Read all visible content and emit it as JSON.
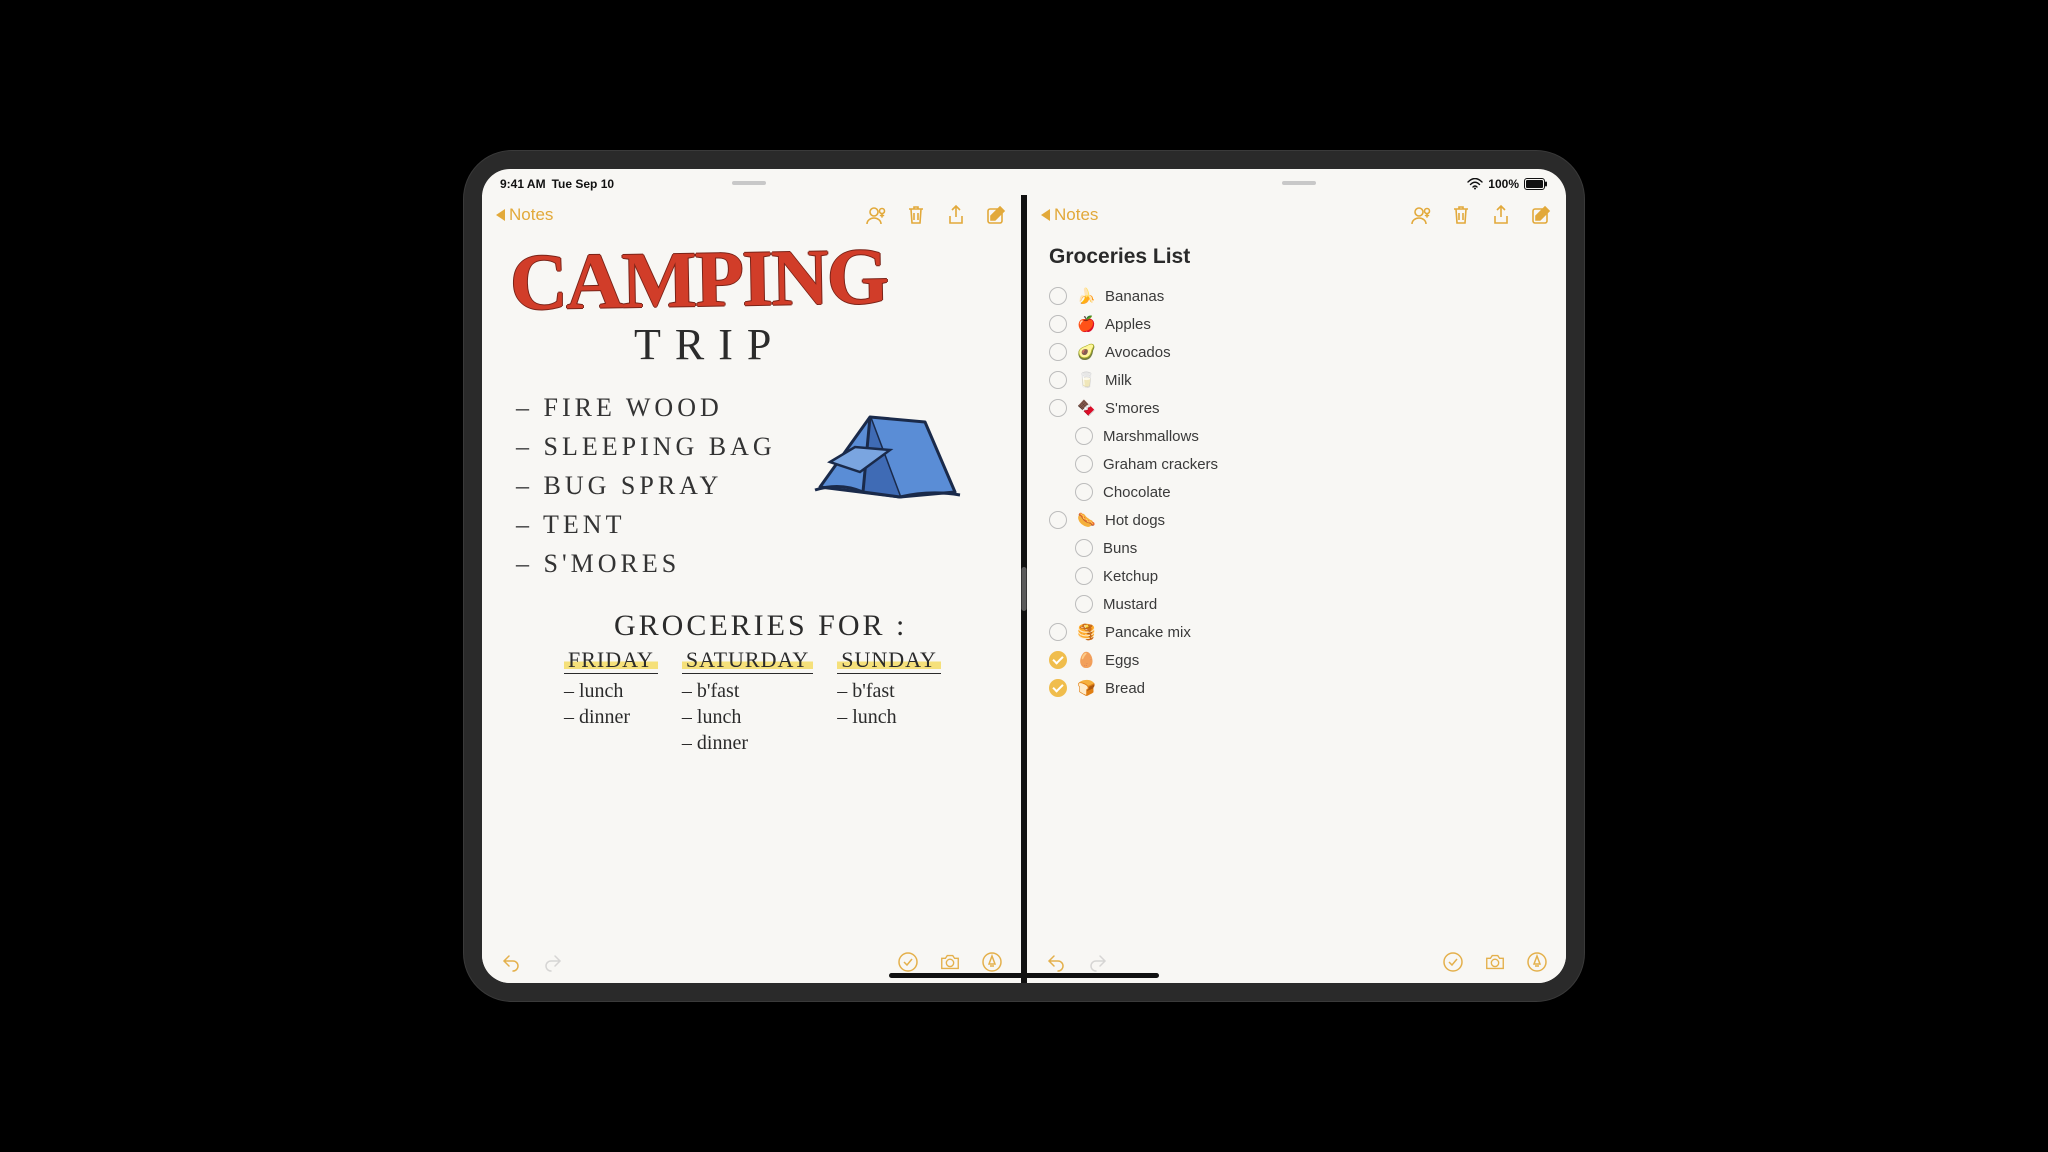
{
  "statusbar": {
    "time": "9:41 AM",
    "date": "Tue Sep 10",
    "battery": "100%"
  },
  "accent": "#e2a93a",
  "left": {
    "back": "Notes",
    "hand_title": "CAMPING",
    "hand_sub": "TRIP",
    "supplies": [
      "FIRE WOOD",
      "SLEEPING BAG",
      "BUG SPRAY",
      "TENT",
      "S'MORES"
    ],
    "groceries_heading": "GROCERIES FOR :",
    "days": [
      {
        "name": "FRIDAY",
        "meals": [
          "lunch",
          "dinner"
        ]
      },
      {
        "name": "SATURDAY",
        "meals": [
          "b'fast",
          "lunch",
          "dinner"
        ]
      },
      {
        "name": "SUNDAY",
        "meals": [
          "b'fast",
          "lunch"
        ]
      }
    ]
  },
  "right": {
    "back": "Notes",
    "title": "Groceries List",
    "items": [
      {
        "emoji": "🍌",
        "label": "Bananas",
        "checked": false,
        "sub": false
      },
      {
        "emoji": "🍎",
        "label": "Apples",
        "checked": false,
        "sub": false
      },
      {
        "emoji": "🥑",
        "label": "Avocados",
        "checked": false,
        "sub": false
      },
      {
        "emoji": "🥛",
        "label": "Milk",
        "checked": false,
        "sub": false
      },
      {
        "emoji": "🍫",
        "label": "S'mores",
        "checked": false,
        "sub": false
      },
      {
        "emoji": "",
        "label": "Marshmallows",
        "checked": false,
        "sub": true
      },
      {
        "emoji": "",
        "label": "Graham crackers",
        "checked": false,
        "sub": true
      },
      {
        "emoji": "",
        "label": "Chocolate",
        "checked": false,
        "sub": true
      },
      {
        "emoji": "🌭",
        "label": "Hot dogs",
        "checked": false,
        "sub": false
      },
      {
        "emoji": "",
        "label": "Buns",
        "checked": false,
        "sub": true
      },
      {
        "emoji": "",
        "label": "Ketchup",
        "checked": false,
        "sub": true
      },
      {
        "emoji": "",
        "label": "Mustard",
        "checked": false,
        "sub": true
      },
      {
        "emoji": "🥞",
        "label": "Pancake mix",
        "checked": false,
        "sub": false
      },
      {
        "emoji": "🥚",
        "label": "Eggs",
        "checked": true,
        "sub": false
      },
      {
        "emoji": "🍞",
        "label": "Bread",
        "checked": true,
        "sub": false
      }
    ]
  }
}
